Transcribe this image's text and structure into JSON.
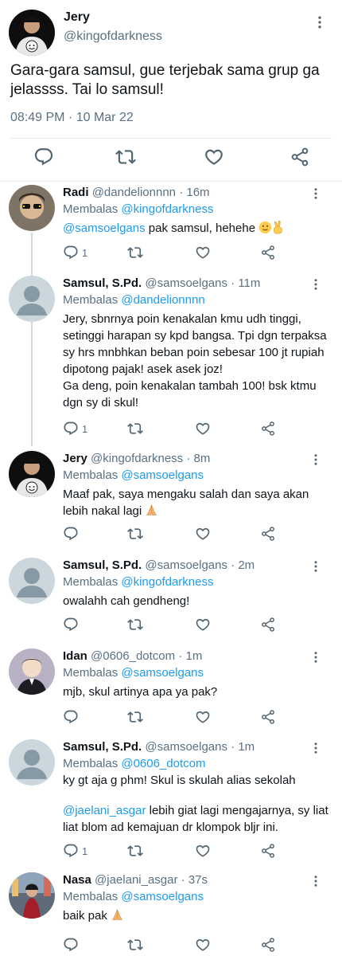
{
  "main_tweet": {
    "name": "Jery",
    "handle": "@kingofdarkness",
    "text": "Gara-gara samsul, gue terjebak sama grup ga jelassss. Tai lo samsul!",
    "time": "08:49 PM · 10 Mar 22"
  },
  "replies": [
    {
      "name": "Radi",
      "handle": "@dandelionnnn",
      "age": "· 16m",
      "replying_prefix": "Membalas ",
      "replying_to": "@kingofdarkness",
      "mention": "@samsoelgans",
      "text": " pak samsul, hehehe",
      "reply_count": "1"
    },
    {
      "name": "Samsul, S.Pd.",
      "handle": "@samsoelgans",
      "age": "· 11m",
      "replying_prefix": "Membalas ",
      "replying_to": "@dandelionnnn",
      "paragraph1": "Jery, sbnrnya poin kenakalan kmu udh tinggi, setinggi harapan sy kpd bangsa. Tpi dgn terpaksa sy hrs mnbhkan beban poin sebesar 100 jt rupiah dipotong pajak! asek asek joz!",
      "paragraph2": "Ga deng, poin kenakalan tambah 100! bsk ktmu dgn sy di skul!",
      "reply_count": "1"
    },
    {
      "name": "Jery",
      "handle": "@kingofdarkness",
      "age": "· 8m",
      "replying_prefix": "Membalas ",
      "replying_to": "@samsoelgans",
      "text": "Maaf pak, saya mengaku salah dan saya akan lebih nakal lagi"
    },
    {
      "name": "Samsul, S.Pd.",
      "handle": "@samsoelgans",
      "age": "· 2m",
      "replying_prefix": "Membalas ",
      "replying_to": "@kingofdarkness",
      "text": "owalahh cah gendheng!"
    },
    {
      "name": "Idan",
      "handle": "@0606_dotcom",
      "age": "· 1m",
      "replying_prefix": "Membalas ",
      "replying_to": "@samsoelgans",
      "text": "mjb, skul artinya apa ya pak?"
    },
    {
      "name": "Samsul, S.Pd.",
      "handle": "@samsoelgans",
      "age": "· 1m",
      "replying_prefix": "Membalas ",
      "replying_to": "@0606_dotcom",
      "paragraph1": "ky gt aja g phm! Skul is skulah alias sekolah",
      "mention": "@jaelani_asgar",
      "paragraph2": " lebih giat lagi mengajarnya, sy liat liat blom ad kemajuan dr klompok bljr ini.",
      "reply_count": "1"
    },
    {
      "name": "Nasa",
      "handle": "@jaelani_asgar",
      "age": "· 37s",
      "replying_prefix": "Membalas ",
      "replying_to": "@samsoelgans",
      "text": "baik pak"
    }
  ],
  "icons": {
    "reply": "reply-icon",
    "retweet": "retweet-icon",
    "like": "heart-icon",
    "share": "share-icon",
    "more": "more-vertical-icon"
  },
  "colors": {
    "link": "#1d9bf0",
    "secondary_text": "#5b7083",
    "icon": "#536471",
    "thread_line": "#cfd9de"
  }
}
